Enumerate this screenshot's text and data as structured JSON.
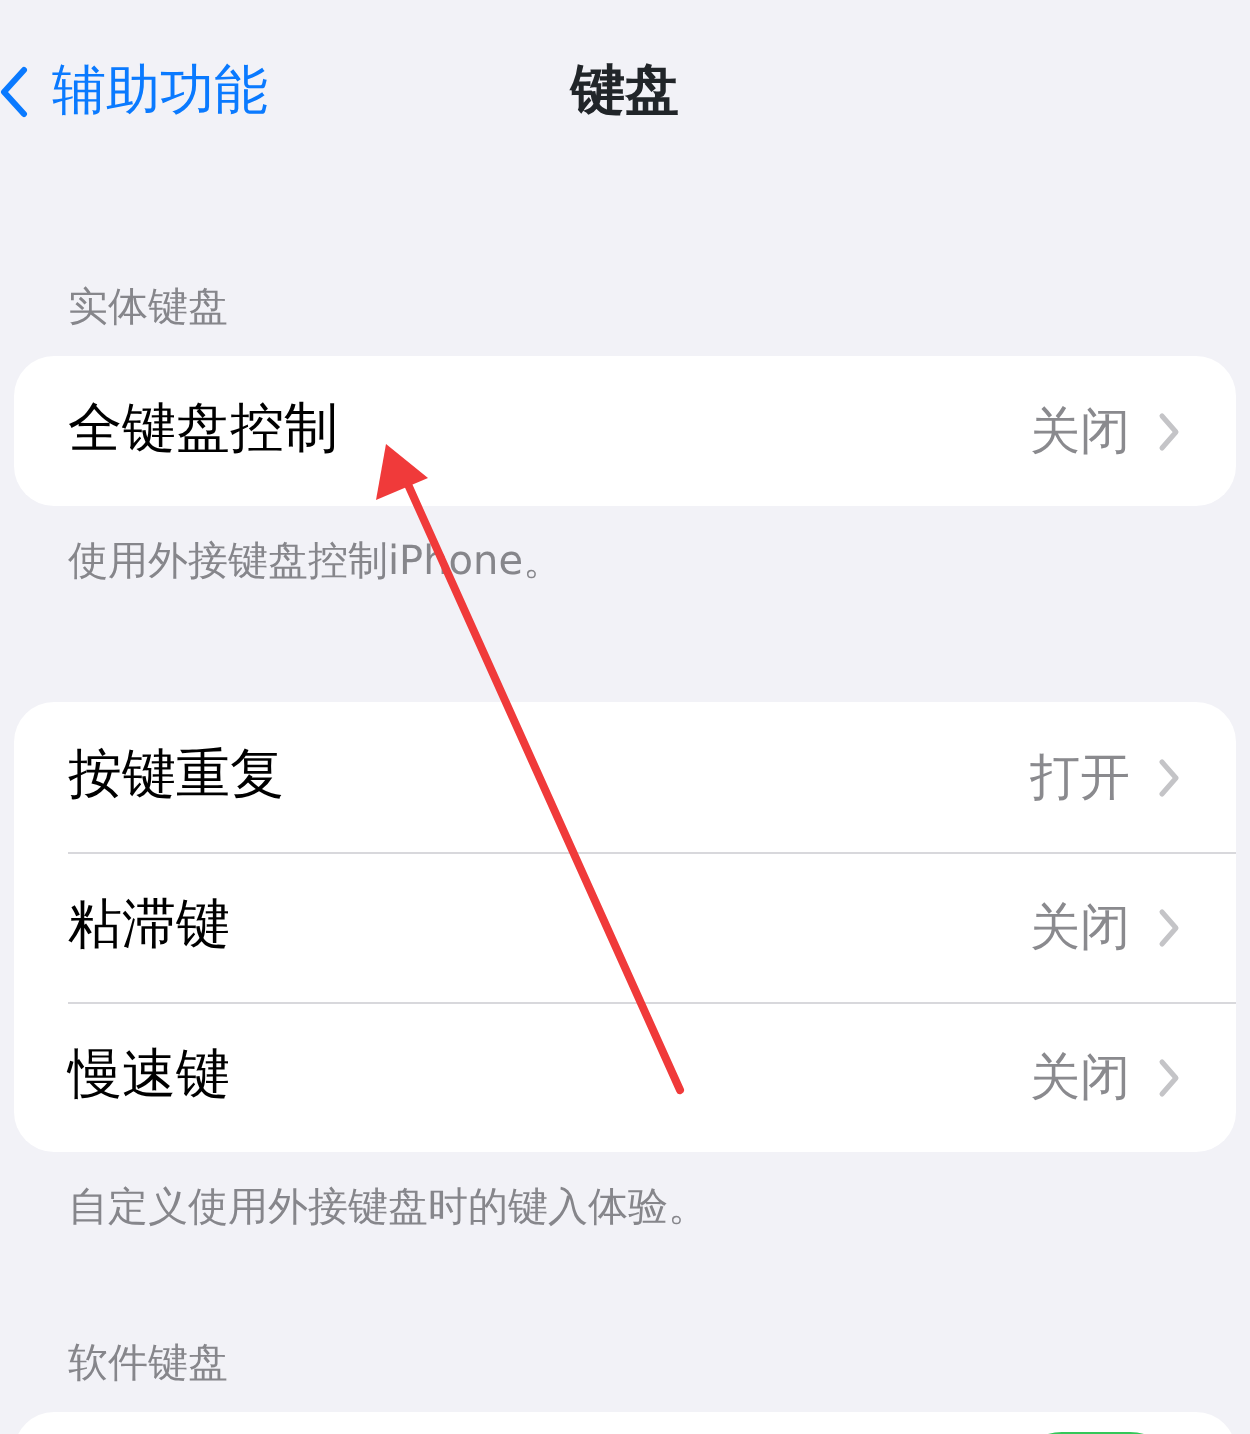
{
  "nav": {
    "back": "辅助功能",
    "title": "键盘"
  },
  "sections": [
    {
      "header": "实体键盘",
      "rows": [
        {
          "label": "全键盘控制",
          "value": "关闭"
        }
      ],
      "footer": "使用外接键盘控制iPhone。"
    },
    {
      "rows": [
        {
          "label": "按键重复",
          "value": "打开"
        },
        {
          "label": "粘滞键",
          "value": "关闭"
        },
        {
          "label": "慢速键",
          "value": "关闭"
        }
      ],
      "footer": "自定义使用外接键盘时的键入体验。"
    },
    {
      "header": "软件键盘",
      "rows": [
        {
          "kind": "toggle",
          "on": true
        }
      ]
    }
  ]
}
